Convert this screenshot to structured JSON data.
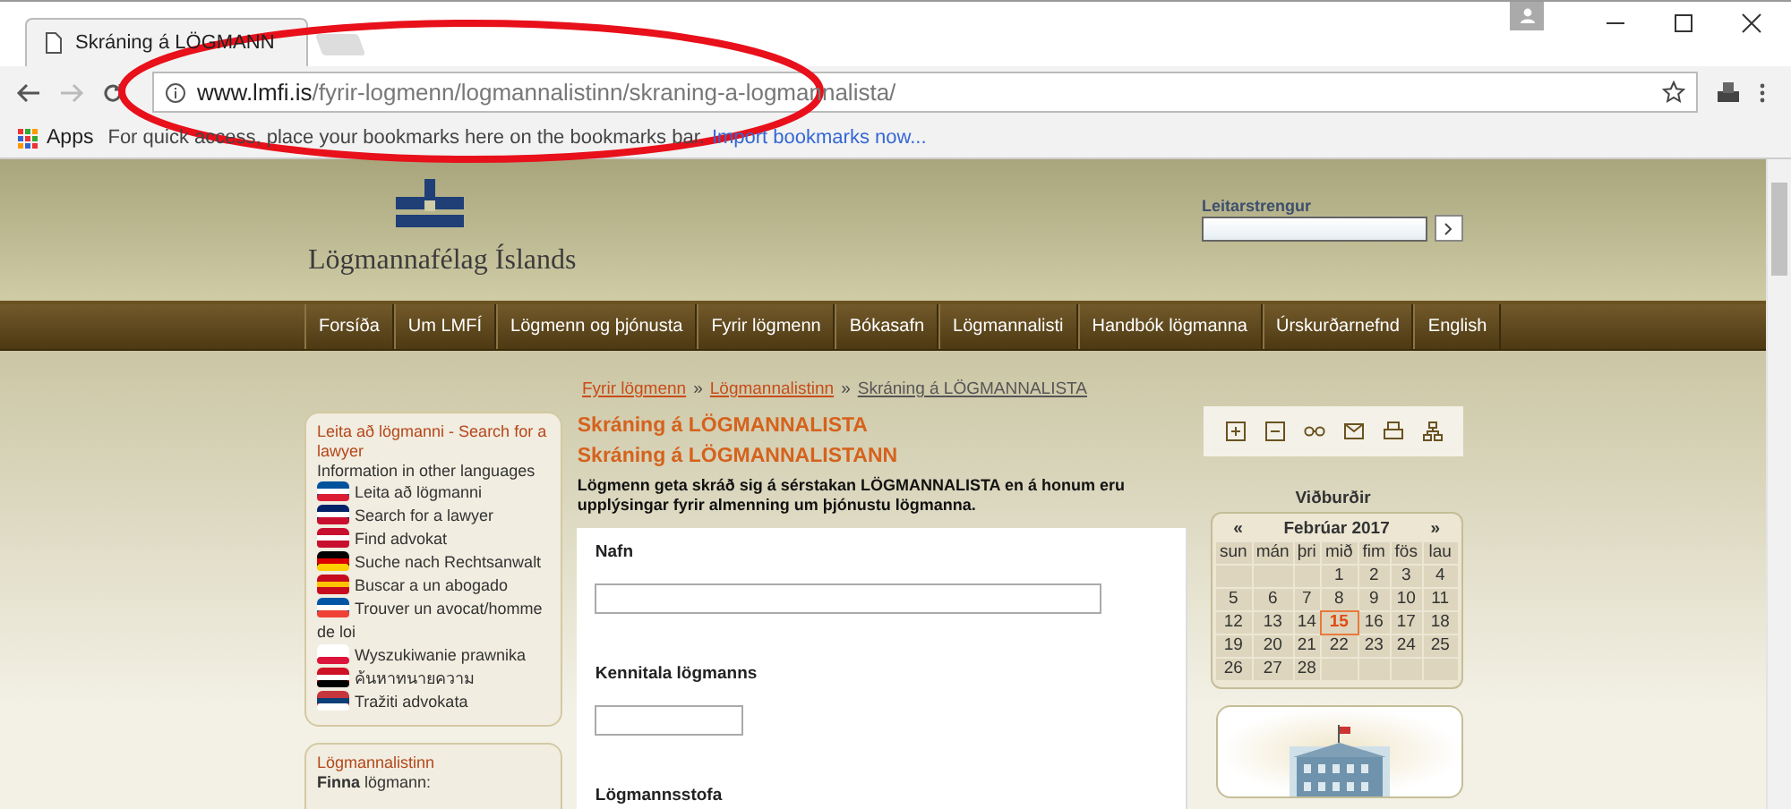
{
  "browser": {
    "tab_title": "Skráning á LÖGMANN",
    "address": {
      "host": "www.lmfi.is",
      "path": "/fyrir-logmenn/logmannalistinn/skraning-a-logmannalista/"
    },
    "bookmarks": {
      "apps": "Apps",
      "hint": "For quick access, place your bookmarks here on the bookmarks bar.",
      "import_link": "Import bookmarks now..."
    }
  },
  "header": {
    "site_name": "Lögmannafélag Íslands",
    "search_label": "Leitarstrengur"
  },
  "nav": [
    "Forsíða",
    "Um LMFÍ",
    "Lögmenn og þjónusta",
    "Fyrir lögmenn",
    "Bókasafn",
    "Lögmannalisti",
    "Handbók lögmanna",
    "Úrskurðarnefnd",
    "English"
  ],
  "breadcrumb": {
    "separator": "»",
    "items": [
      "Fyrir lögmenn",
      "Lögmannalistinn",
      "Skráning á LÖGMANNALISTA"
    ]
  },
  "sidebar": {
    "search_box": {
      "title": "Leita að lögmanni - Search for a lawyer",
      "subtitle": "Information in other languages",
      "languages": [
        "Leita að lögmanni",
        "Search for a lawyer",
        "Find advokat",
        "Suche nach Rechtsanwalt",
        "Buscar a un abogado",
        "Trouver un avocat/homme de loi",
        "Wyszukiwanie prawnika",
        "ค้นหาทนายความ",
        "Tražiti advokata"
      ]
    },
    "list_box": {
      "title": "Lögmannalistinn",
      "subtitle_bold": "Finna",
      "subtitle_rest": "lögmann:"
    }
  },
  "content": {
    "title": "Skráning á LÖGMANNALISTA",
    "subtitle": "Skráning á LÖGMANNALISTANN",
    "intro": "Lögmenn geta skráð sig á sérstakan LÖGMANNALISTA en á honum eru upplýsingar fyrir almenning um þjónustu lögmanna.",
    "fields": [
      {
        "label": "Nafn",
        "kind": "wide"
      },
      {
        "label": "Kennitala lögmanns",
        "kind": "short"
      },
      {
        "label": "Lögmannsstofa",
        "kind": "none"
      }
    ]
  },
  "calendar": {
    "heading": "Viðburðir",
    "month": "Febrúar 2017",
    "prev": "«",
    "next": "»",
    "weekdays": [
      "sun",
      "mán",
      "þri",
      "mið",
      "fim",
      "fös",
      "lau"
    ],
    "weeks": [
      {
        "kind": "tail",
        "days": [
          {
            "day": "1",
            "selected": false
          },
          {
            "day": "2",
            "selected": false
          },
          {
            "day": "3",
            "selected": false
          },
          {
            "day": "4",
            "selected": false
          }
        ]
      },
      {
        "kind": "full",
        "days": [
          {
            "day": "5",
            "selected": false
          },
          {
            "day": "6",
            "selected": false
          },
          {
            "day": "7",
            "selected": false
          },
          {
            "day": "8",
            "selected": false
          },
          {
            "day": "9",
            "selected": false
          },
          {
            "day": "10",
            "selected": false
          },
          {
            "day": "11",
            "selected": false
          }
        ]
      },
      {
        "kind": "full",
        "days": [
          {
            "day": "12",
            "selected": false
          },
          {
            "day": "13",
            "selected": false
          },
          {
            "day": "14",
            "selected": false
          },
          {
            "day": "15",
            "selected": true
          },
          {
            "day": "16",
            "selected": false
          },
          {
            "day": "17",
            "selected": false
          },
          {
            "day": "18",
            "selected": false
          }
        ]
      },
      {
        "kind": "full",
        "days": [
          {
            "day": "19",
            "selected": false
          },
          {
            "day": "20",
            "selected": false
          },
          {
            "day": "21",
            "selected": false
          },
          {
            "day": "22",
            "selected": false
          },
          {
            "day": "23",
            "selected": false
          },
          {
            "day": "24",
            "selected": false
          },
          {
            "day": "25",
            "selected": false
          }
        ]
      },
      {
        "kind": "head",
        "days": [
          {
            "day": "26",
            "selected": false
          },
          {
            "day": "27",
            "selected": false
          },
          {
            "day": "28",
            "selected": false
          }
        ]
      }
    ]
  }
}
